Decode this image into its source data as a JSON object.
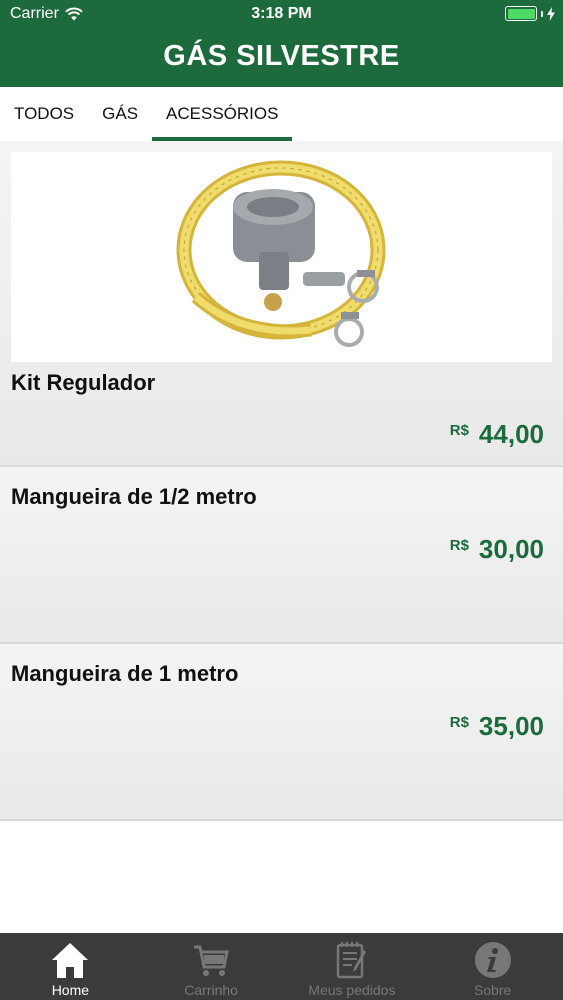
{
  "status_bar": {
    "carrier": "Carrier",
    "time": "3:18 PM"
  },
  "header": {
    "title": "GÁS SILVESTRE"
  },
  "tabs": [
    {
      "label": "TODOS",
      "active": false
    },
    {
      "label": "GÁS",
      "active": false
    },
    {
      "label": "ACESSÓRIOS",
      "active": true
    }
  ],
  "products": [
    {
      "name": "Kit Regulador",
      "currency": "R$",
      "price": "44,00",
      "image": "gas-regulator-hose-kit"
    },
    {
      "name": "Mangueira de 1/2 metro",
      "currency": "R$",
      "price": "30,00"
    },
    {
      "name": "Mangueira de 1 metro",
      "currency": "R$",
      "price": "35,00"
    }
  ],
  "tab_bar": [
    {
      "label": "Home",
      "icon": "home-icon",
      "active": true
    },
    {
      "label": "Carrinho",
      "icon": "cart-icon",
      "active": false
    },
    {
      "label": "Meus pedidos",
      "icon": "orders-icon",
      "active": false
    },
    {
      "label": "Sobre",
      "icon": "info-icon",
      "active": false
    }
  ],
  "colors": {
    "brand_green": "#1d6b3d",
    "tab_bar": "#3b3b3b",
    "battery": "#4cd964"
  }
}
